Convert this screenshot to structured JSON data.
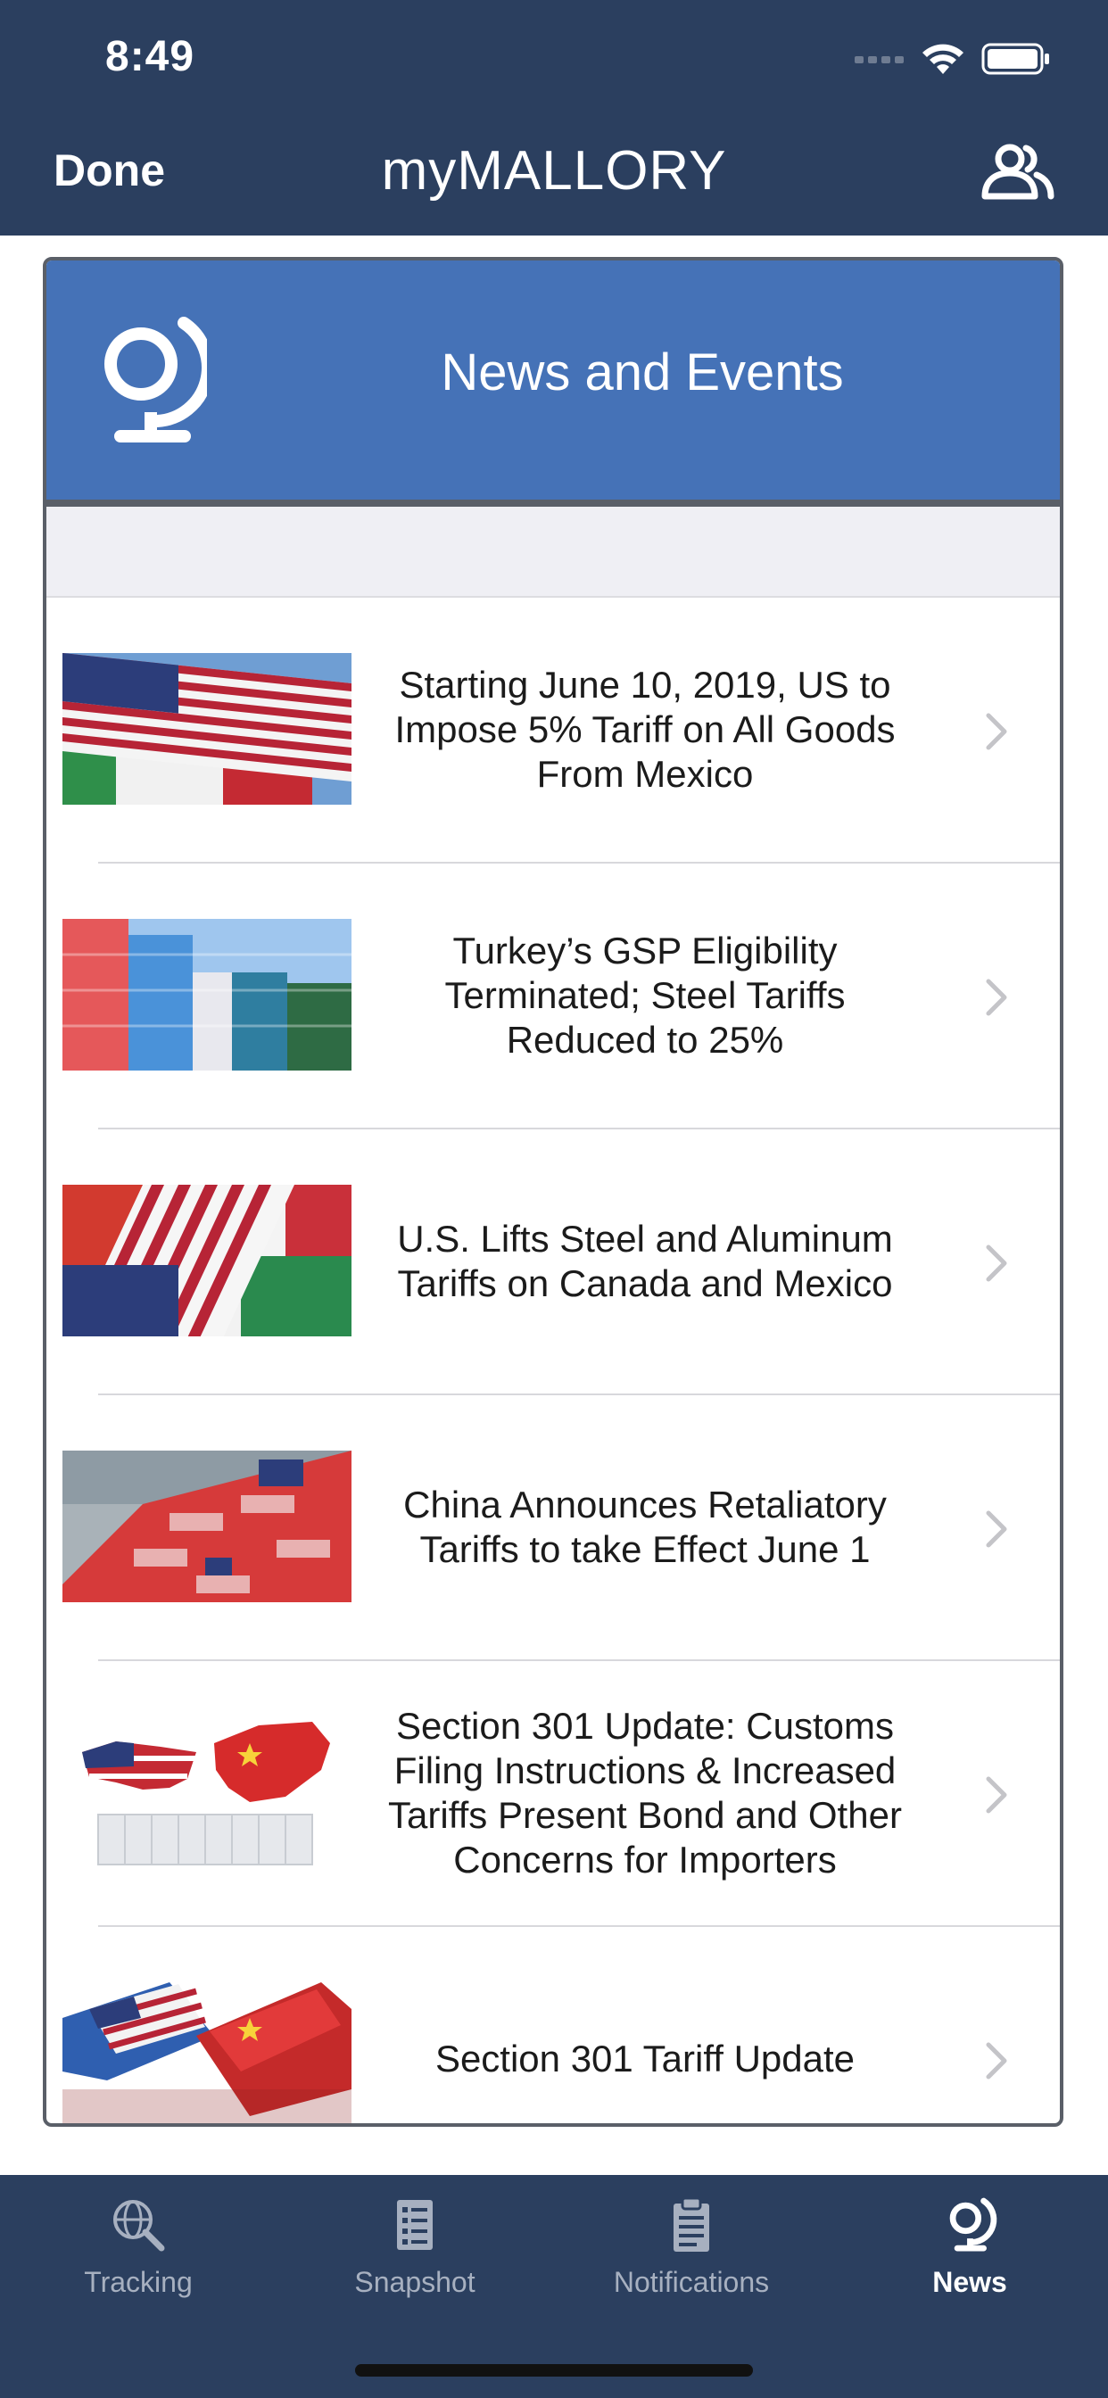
{
  "status_bar": {
    "time": "8:49"
  },
  "nav": {
    "done_label": "Done",
    "title": "myMALLORY",
    "users_icon": "users-icon"
  },
  "card": {
    "title": "News and Events",
    "icon": "globe-icon"
  },
  "news": [
    {
      "title": "Starting June 10, 2019, US to Impose 5% Tariff on All Goods From Mexico",
      "image": "us-mexico-flags"
    },
    {
      "title": "Turkey’s GSP Eligibility Terminated; Steel Tariffs Reduced to 25%",
      "image": "shipping-containers"
    },
    {
      "title": "U.S. Lifts Steel and Aluminum Tariffs on Canada and Mexico",
      "image": "canada-us-mexico-flags"
    },
    {
      "title": "China Announces Retaliatory Tariffs to take Effect June 1",
      "image": "china-us-containers"
    },
    {
      "title": "Section 301 Update: Customs Filing Instructions & Increased Tariffs Present Bond and Other Concerns for Importers",
      "image": "us-china-map-container"
    },
    {
      "title": "Section 301 Tariff Update",
      "image": "us-china-colliding-containers"
    }
  ],
  "tabs": [
    {
      "label": "Tracking",
      "icon": "globe-search-icon",
      "active": false
    },
    {
      "label": "Snapshot",
      "icon": "list-document-icon",
      "active": false
    },
    {
      "label": "Notifications",
      "icon": "clipboard-icon",
      "active": false
    },
    {
      "label": "News",
      "icon": "globe-icon",
      "active": true
    }
  ],
  "colors": {
    "nav_bg": "#2b3f5f",
    "card_header": "#4572b7",
    "tab_active": "#ffffff",
    "tab_inactive": "#a7b0c0"
  }
}
